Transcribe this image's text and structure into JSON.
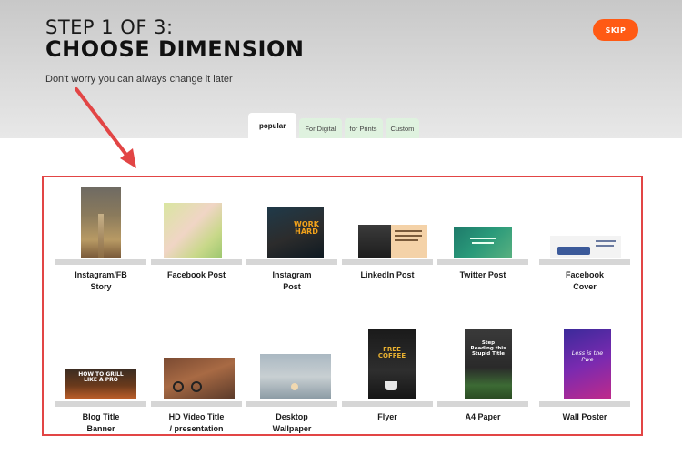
{
  "header": {
    "step_label": "STEP 1 OF 3:",
    "title": "CHOOSE DIMENSION",
    "subtitle": "Don't worry you can always change it later",
    "skip_label": "SKIP"
  },
  "tabs": [
    {
      "label": "popular",
      "active": true
    },
    {
      "label": "For Digital",
      "active": false
    },
    {
      "label": "for Prints",
      "active": false
    },
    {
      "label": "Custom",
      "active": false
    }
  ],
  "templates": [
    {
      "label_line1": "Instagram/FB",
      "label_line2": "Story"
    },
    {
      "label_line1": "Facebook Post",
      "label_line2": ""
    },
    {
      "label_line1": "Instagram",
      "label_line2": "Post"
    },
    {
      "label_line1": "LinkedIn Post",
      "label_line2": ""
    },
    {
      "label_line1": "Twitter Post",
      "label_line2": ""
    },
    {
      "label_line1": "Facebook",
      "label_line2": "Cover"
    },
    {
      "label_line1": "Blog Title",
      "label_line2": "Banner"
    },
    {
      "label_line1": "HD Video Title",
      "label_line2": "/ presentation"
    },
    {
      "label_line1": "Desktop",
      "label_line2": "Wallpaper"
    },
    {
      "label_line1": "Flyer",
      "label_line2": ""
    },
    {
      "label_line1": "A4 Paper",
      "label_line2": ""
    },
    {
      "label_line1": "Wall Poster",
      "label_line2": ""
    }
  ],
  "thumb_text": {
    "instagram_post": "WORK HARD",
    "blog_banner": "HOW TO GRILL LIKE A PRO",
    "flyer": "FREE COFFEE",
    "a4": "Step Reading this Stupid Title",
    "poster": "Less is the Pwe"
  },
  "colors": {
    "accent": "#ff5a14",
    "panel_border": "#e24545",
    "tab_bg": "#dff2df"
  }
}
